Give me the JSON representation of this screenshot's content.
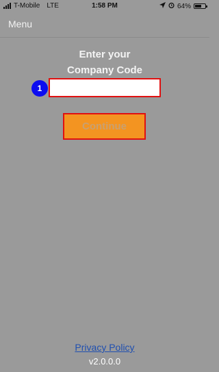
{
  "status_bar": {
    "carrier": "T-Mobile",
    "network": "LTE",
    "time": "1:58 PM",
    "battery": "64%",
    "battery_level": 0.64,
    "icons": [
      "signal-icon",
      "location-arrow-icon",
      "alarm-icon",
      "battery-icon"
    ]
  },
  "nav": {
    "menu_label": "Menu"
  },
  "main": {
    "heading_line1": "Enter your",
    "heading_line2": "Company Code",
    "step_number": "1",
    "input_value": "",
    "continue_label": "Continue"
  },
  "footer": {
    "privacy_label": "Privacy Policy",
    "version": "v2.0.0.0"
  },
  "colors": {
    "background": "#9a9a9a",
    "accent_orange": "#f39421",
    "highlight_red": "#e01010",
    "badge_blue": "#0c0cf0",
    "link_blue": "#1f4fb0"
  }
}
